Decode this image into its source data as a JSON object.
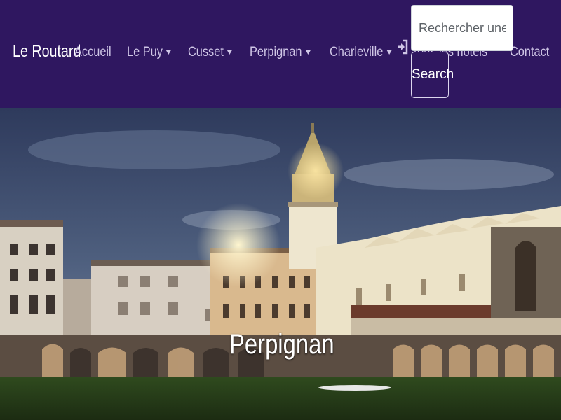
{
  "navbar": {
    "brand": "Le Routard",
    "links": [
      {
        "label": "Accueil",
        "dropdown": false
      },
      {
        "label": "Le Puy",
        "dropdown": true
      },
      {
        "label": "Cusset",
        "dropdown": true
      },
      {
        "label": "Perpignan",
        "dropdown": true
      },
      {
        "label": "Charleville",
        "dropdown": true
      },
      {
        "label": "Tous les hôtels",
        "dropdown": false
      },
      {
        "label": "Contact",
        "dropdown": false
      }
    ],
    "login_icon": "sign-in-icon",
    "search": {
      "placeholder": "Rechercher une ville",
      "value": "",
      "button_label": "Search"
    }
  },
  "hero": {
    "title": "Perpignan",
    "image_subject": "night photograph of Perpignan cathedral and cloister"
  },
  "colors": {
    "navbar_bg": "#2f1760",
    "nav_link": "#cfc6e6",
    "brand": "#ffffff"
  }
}
